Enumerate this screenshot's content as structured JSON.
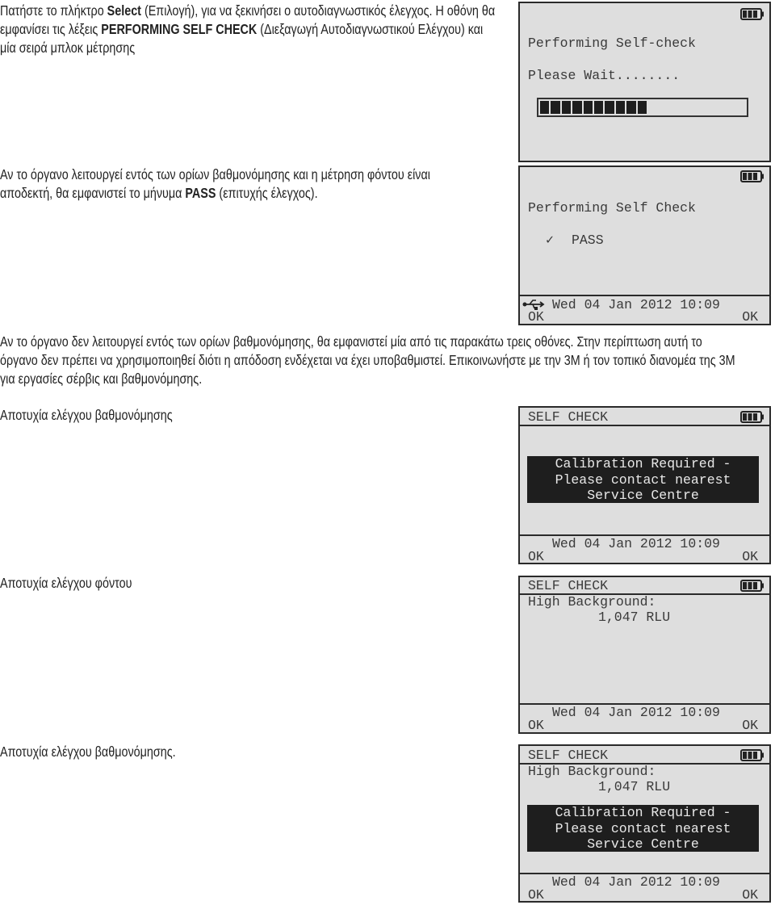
{
  "paragraphs": {
    "intro": [
      [
        {
          "t": "Πατήστε το πλήκτρο "
        },
        {
          "t": "Select",
          "b": true
        },
        {
          "t": " (Επιλογή), για να ξεκινήσει ο αυτοδιαγνωστικός έλεγχος. Η οθόνη θα"
        }
      ],
      [
        {
          "t": "εμφανίσει τις λέξεις "
        },
        {
          "t": "PERFORMING SELF CHECK",
          "b": true
        },
        {
          "t": " (Διεξαγωγή Αυτοδιαγνωστικού Ελέγχου) και"
        }
      ],
      [
        {
          "t": "μία σειρά μπλοκ μέτρησης"
        }
      ]
    ],
    "pass": [
      [
        {
          "t": "Αν το όργανο λειτουργεί εντός των ορίων βαθμονόμησης και η μέτρηση φόντου είναι"
        }
      ],
      [
        {
          "t": "αποδεκτή, θα εμφανιστεί το μήνυμα "
        },
        {
          "t": "PASS",
          "b": true
        },
        {
          "t": " (επιτυχής έλεγχος)."
        }
      ]
    ],
    "fail": [
      [
        {
          "t": "Αν το όργανο δεν λειτουργεί εντός των ορίων βαθμονόμησης, θα εμφανιστεί μία από τις παρακάτω τρεις οθόνες. Στην περίπτωση αυτή το"
        }
      ],
      [
        {
          "t": "όργανο δεν πρέπει να χρησιμοποιηθεί διότι η απόδοση ενδέχεται να έχει υποβαθμιστεί. Επικοινωνήστε με την 3M ή τον τοπικό διανομέα της 3M"
        }
      ],
      [
        {
          "t": "για εργασίες σέρβις και βαθμονόμησης."
        }
      ]
    ]
  },
  "labels": {
    "cal_fail": "Αποτυχία ελέγχου βαθμονόμησης",
    "bg_fail": "Αποτυχία ελέγχου φόντου",
    "cal_fail2": "Αποτυχία ελέγχου βαθμονόμησης."
  },
  "screens": {
    "progress": {
      "title": "Performing Self-check",
      "wait": "Please Wait........",
      "progress_blocks_filled": 10,
      "progress_blocks_total": 20,
      "battery": "battery-full-icon"
    },
    "pass": {
      "title": "Performing Self Check",
      "check": "✓",
      "result": "PASS",
      "datetime": "Wed 04 Jan 2012 10:09",
      "ok_left": "OK",
      "ok_right": "OK",
      "usb": "usb-icon"
    },
    "cal": {
      "header": "SELF CHECK",
      "msg": [
        "Calibration Required -",
        "Please contact nearest",
        "Service Centre"
      ],
      "datetime": "Wed 04 Jan 2012 10:09",
      "ok_left": "OK",
      "ok_right": "OK"
    },
    "bg": {
      "header": "SELF CHECK",
      "line1": "High Background:",
      "line2": "1,047 RLU",
      "datetime": "Wed 04 Jan 2012 10:09",
      "ok_left": "OK",
      "ok_right": "OK"
    },
    "both": {
      "header": "SELF CHECK",
      "line1": "High Background:",
      "line2": "1,047 RLU",
      "msg": [
        "Calibration Required -",
        "Please contact nearest",
        "Service Centre"
      ],
      "datetime": "Wed 04 Jan 2012 10:09",
      "ok_left": "OK",
      "ok_right": "OK"
    }
  }
}
